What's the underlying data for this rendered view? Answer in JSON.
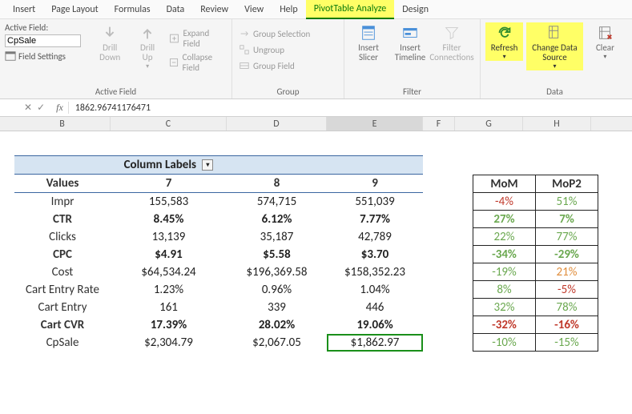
{
  "ribbon_tabs": {
    "insert": "Insert",
    "page_layout": "Page Layout",
    "formulas": "Formulas",
    "data": "Data",
    "review": "Review",
    "view": "View",
    "help": "Help",
    "pivot_analyze": "PivotTable Analyze",
    "design": "Design"
  },
  "active_field": {
    "label": "Active Field:",
    "value": "CpSale",
    "field_settings": "Field Settings",
    "drill_down": "Drill\nDown",
    "drill_up": "Drill\nUp",
    "expand_field": "Expand Field",
    "collapse_field": "Collapse Field",
    "group_label": "Active Field"
  },
  "group_sect": {
    "group_selection": "Group Selection",
    "ungroup": "Ungroup",
    "group_field": "Group Field",
    "group_label": "Group"
  },
  "filter_sect": {
    "insert_slicer": "Insert\nSlicer",
    "insert_timeline": "Insert\nTimeline",
    "filter_conn": "Filter\nConnections",
    "group_label": "Filter"
  },
  "data_sect": {
    "refresh": "Refresh",
    "change_source": "Change Data\nSource",
    "clear": "Clear",
    "group_label": "Data"
  },
  "formula_bar": {
    "value": "1862.96741176471"
  },
  "columns": {
    "B": "B",
    "C": "C",
    "D": "D",
    "E": "E",
    "F": "F",
    "G": "G",
    "H": "H"
  },
  "pivot": {
    "column_labels": "Column Labels",
    "values_label": "Values",
    "col_headers": {
      "c7": "7",
      "c8": "8",
      "c9": "9"
    },
    "rows": {
      "impr": {
        "label": "Impr",
        "v7": "155,583",
        "v8": "574,715",
        "v9": "551,039"
      },
      "ctr": {
        "label": "CTR",
        "v7": "8.45%",
        "v8": "6.12%",
        "v9": "7.77%"
      },
      "clicks": {
        "label": "Clicks",
        "v7": "13,139",
        "v8": "35,187",
        "v9": "42,789"
      },
      "cpc": {
        "label": "CPC",
        "v7": "$4.91",
        "v8": "$5.58",
        "v9": "$3.70"
      },
      "cost": {
        "label": "Cost",
        "v7": "$64,534.24",
        "v8": "$196,369.58",
        "v9": "$158,352.23"
      },
      "cer": {
        "label": "Cart Entry Rate",
        "v7": "1.23%",
        "v8": "0.96%",
        "v9": "1.04%"
      },
      "centry": {
        "label": "Cart Entry",
        "v7": "161",
        "v8": "339",
        "v9": "446"
      },
      "cvr": {
        "label": "Cart CVR",
        "v7": "17.39%",
        "v8": "28.02%",
        "v9": "19.06%"
      },
      "cpsale": {
        "label": "CpSale",
        "v7": "$2,304.79",
        "v8": "$2,067.05",
        "v9": "$1,862.97"
      }
    }
  },
  "mom": {
    "h1": "MoM",
    "h2": "MoP2",
    "rows": {
      "impr": {
        "a": "-4%",
        "b": "51%"
      },
      "ctr": {
        "a": "27%",
        "b": "7%"
      },
      "clicks": {
        "a": "22%",
        "b": "77%"
      },
      "cpc": {
        "a": "-34%",
        "b": "-29%"
      },
      "cost": {
        "a": "-19%",
        "b": "21%"
      },
      "cer": {
        "a": "8%",
        "b": "-5%"
      },
      "centry": {
        "a": "32%",
        "b": "78%"
      },
      "cvr": {
        "a": "-32%",
        "b": "-16%"
      },
      "cpsale": {
        "a": "-10%",
        "b": "-15%"
      }
    }
  },
  "chart_data": {
    "type": "table",
    "row_metrics": [
      "Impr",
      "CTR",
      "Clicks",
      "CPC",
      "Cost",
      "Cart Entry Rate",
      "Cart Entry",
      "Cart CVR",
      "CpSale"
    ],
    "columns": [
      "7",
      "8",
      "9"
    ],
    "values": [
      [
        155583,
        574715,
        551039
      ],
      [
        0.0845,
        0.0612,
        0.0777
      ],
      [
        13139,
        35187,
        42789
      ],
      [
        4.91,
        5.58,
        3.7
      ],
      [
        64534.24,
        196369.58,
        158352.23
      ],
      [
        0.0123,
        0.0096,
        0.0104
      ],
      [
        161,
        339,
        446
      ],
      [
        0.1739,
        0.2802,
        0.1906
      ],
      [
        2304.79,
        2067.05,
        1862.97
      ]
    ],
    "mom_percent": [
      -4,
      27,
      22,
      -34,
      -19,
      8,
      32,
      -32,
      -10
    ],
    "mop2_percent": [
      51,
      7,
      77,
      -29,
      21,
      -5,
      78,
      -16,
      -15
    ]
  }
}
